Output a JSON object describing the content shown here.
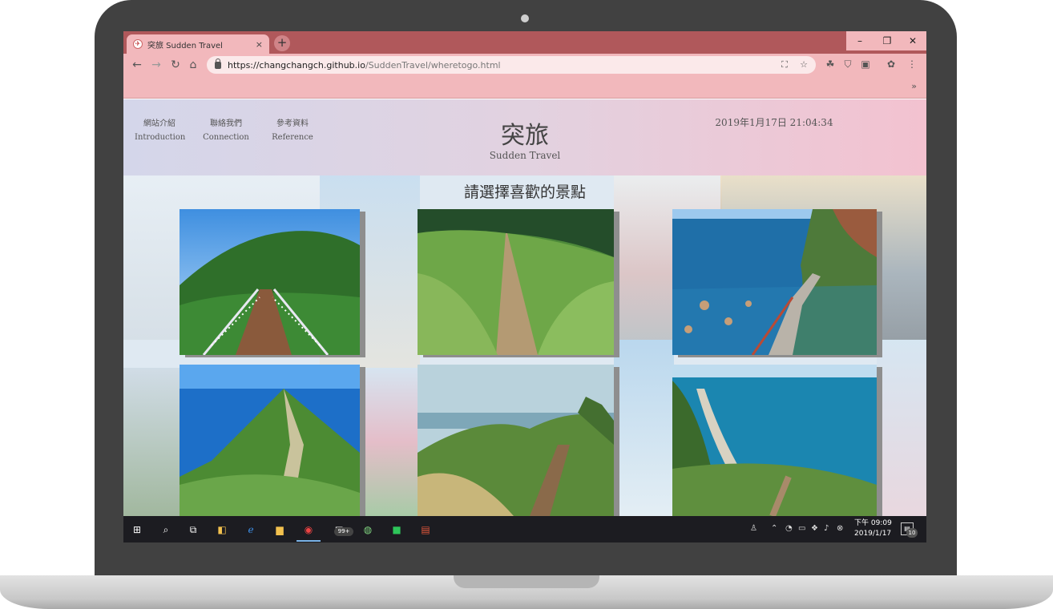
{
  "browser": {
    "tab_title": "突旅 Sudden Travel",
    "tab_close": "×",
    "new_tab": "+",
    "window_controls": {
      "minimize": "–",
      "maximize": "❐",
      "close": "✕"
    },
    "url_host": "https://changchangch.github.io",
    "url_path": "/SuddenTravel/wheretogo.html",
    "bookmarks_more": "»",
    "accent_color": "#b0585b",
    "toolbar_color": "#f2b8bc"
  },
  "header": {
    "nav": [
      {
        "zh": "網站介紹",
        "en": "Introduction"
      },
      {
        "zh": "聯絡我們",
        "en": "Connection"
      },
      {
        "zh": "參考資料",
        "en": "Reference"
      }
    ],
    "brand_zh": "突旅",
    "brand_en": "Sudden Travel",
    "datetime": "2019年1月17日 21:04:34"
  },
  "main": {
    "title": "請選擇喜歡的景點",
    "cards": [
      {
        "name": "suspension-bridge-photo"
      },
      {
        "name": "grassy-trail-photo"
      },
      {
        "name": "coastal-cliff-stairs-photo"
      },
      {
        "name": "green-ridge-coast-photo"
      },
      {
        "name": "silvergrass-trail-photo"
      },
      {
        "name": "east-coast-bay-photo"
      }
    ]
  },
  "taskbar": {
    "mail_badge": "99+",
    "clock_time": "下午 09:09",
    "clock_date": "2019/1/17",
    "notification_count": "10"
  }
}
